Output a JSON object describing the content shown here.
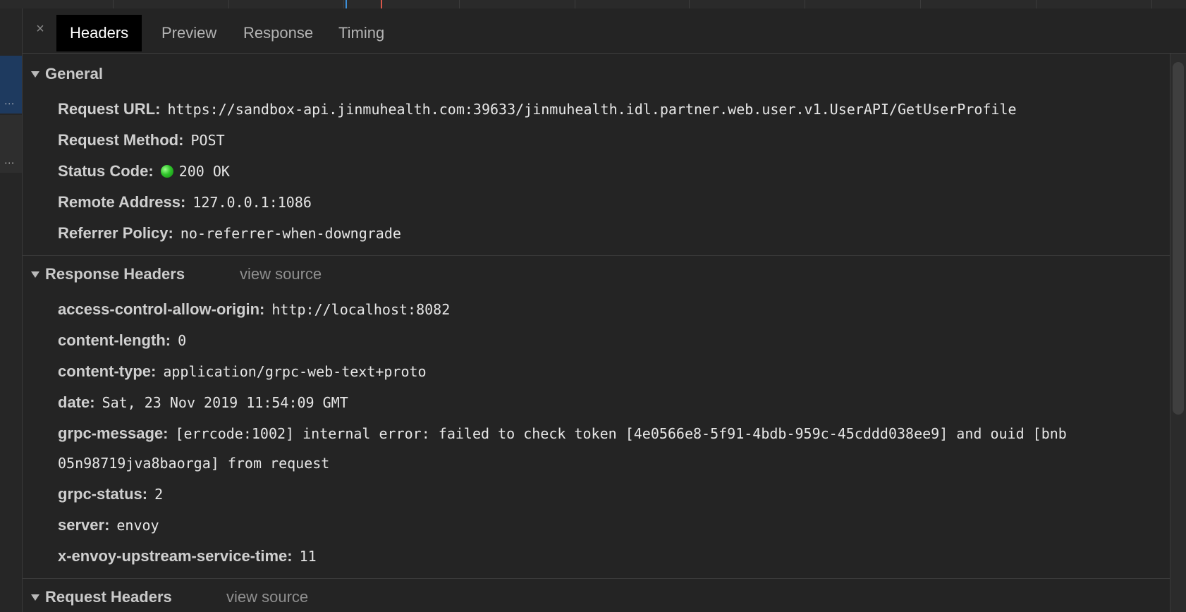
{
  "tabs": [
    {
      "label": "Headers",
      "active": true
    },
    {
      "label": "Preview",
      "active": false
    },
    {
      "label": "Response",
      "active": false
    },
    {
      "label": "Timing",
      "active": false
    }
  ],
  "close_icon": "×",
  "general": {
    "title": "General",
    "rows": [
      {
        "key": "Request URL:",
        "value": "https://sandbox-api.jinmuhealth.com:39633/jinmuhealth.idl.partner.web.user.v1.UserAPI/GetUserProfile"
      },
      {
        "key": "Request Method:",
        "value": "POST"
      },
      {
        "key": "Status Code:",
        "value": "200 OK",
        "status_color": "#2fc42a"
      },
      {
        "key": "Remote Address:",
        "value": "127.0.0.1:1086"
      },
      {
        "key": "Referrer Policy:",
        "value": "no-referrer-when-downgrade"
      }
    ]
  },
  "response_headers": {
    "title": "Response Headers",
    "view_source": "view source",
    "rows": [
      {
        "key": "access-control-allow-origin:",
        "value": "http://localhost:8082"
      },
      {
        "key": "content-length:",
        "value": "0"
      },
      {
        "key": "content-type:",
        "value": "application/grpc-web-text+proto"
      },
      {
        "key": "date:",
        "value": "Sat, 23 Nov 2019 11:54:09 GMT"
      },
      {
        "key": "grpc-message:",
        "value": "[errcode:1002] internal error: failed to check token [4e0566e8-5f91-4bdb-959c-45cddd038ee9] and ouid [bnb",
        "value_continued": "05n98719jva8baorga] from request"
      },
      {
        "key": "grpc-status:",
        "value": "2"
      },
      {
        "key": "server:",
        "value": "envoy"
      },
      {
        "key": "x-envoy-upstream-service-time:",
        "value": "11"
      }
    ]
  },
  "request_headers": {
    "title": "Request Headers",
    "view_source": "view source"
  },
  "left_list": {
    "ellipsis": "..."
  },
  "colors": {
    "background": "#242424",
    "active_tab_bg": "#000000",
    "selected_row": "#1e3a5f",
    "status_ok": "#2fc42a"
  }
}
